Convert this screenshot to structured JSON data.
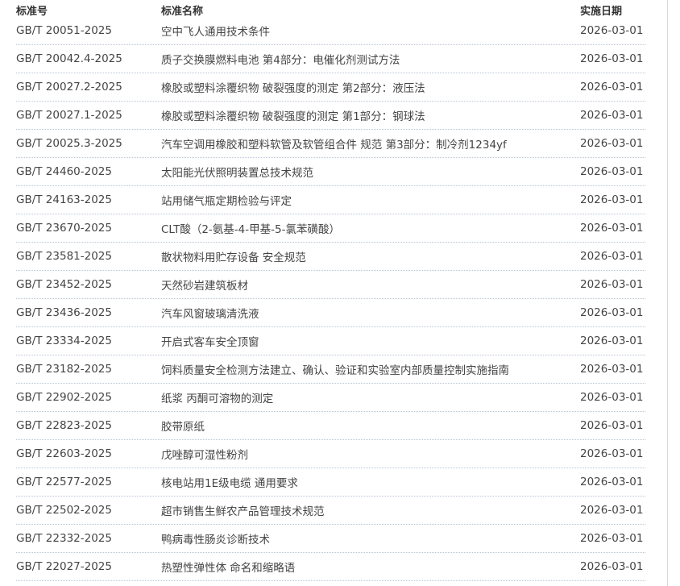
{
  "table": {
    "headers": {
      "code": "标准号",
      "name": "标准名称",
      "date": "实施日期"
    },
    "rows": [
      {
        "code": "GB/T 20051-2025",
        "name": "空中飞人通用技术条件",
        "date": "2026-03-01"
      },
      {
        "code": "GB/T 20042.4-2025",
        "name": "质子交换膜燃料电池 第4部分：电催化剂测试方法",
        "date": "2026-03-01"
      },
      {
        "code": "GB/T 20027.2-2025",
        "name": "橡胶或塑料涂覆织物 破裂强度的测定 第2部分：液压法",
        "date": "2026-03-01"
      },
      {
        "code": "GB/T 20027.1-2025",
        "name": "橡胶或塑料涂覆织物 破裂强度的测定 第1部分：钢球法",
        "date": "2026-03-01"
      },
      {
        "code": "GB/T 20025.3-2025",
        "name": "汽车空调用橡胶和塑料软管及软管组合件 规范 第3部分：制冷剂1234yf",
        "date": "2026-03-01"
      },
      {
        "code": "GB/T 24460-2025",
        "name": "太阳能光伏照明装置总技术规范",
        "date": "2026-03-01"
      },
      {
        "code": "GB/T 24163-2025",
        "name": "站用储气瓶定期检验与评定",
        "date": "2026-03-01"
      },
      {
        "code": "GB/T 23670-2025",
        "name": "CLT酸（2-氨基-4-甲基-5-氯苯磺酸）",
        "date": "2026-03-01"
      },
      {
        "code": "GB/T 23581-2025",
        "name": "散状物料用贮存设备 安全规范",
        "date": "2026-03-01"
      },
      {
        "code": "GB/T 23452-2025",
        "name": "天然砂岩建筑板材",
        "date": "2026-03-01"
      },
      {
        "code": "GB/T 23436-2025",
        "name": "汽车风窗玻璃清洗液",
        "date": "2026-03-01"
      },
      {
        "code": "GB/T 23334-2025",
        "name": "开启式客车安全顶窗",
        "date": "2026-03-01"
      },
      {
        "code": "GB/T 23182-2025",
        "name": "饲料质量安全检测方法建立、确认、验证和实验室内部质量控制实施指南",
        "date": "2026-03-01"
      },
      {
        "code": "GB/T 22902-2025",
        "name": "纸浆 丙酮可溶物的测定",
        "date": "2026-03-01"
      },
      {
        "code": "GB/T 22823-2025",
        "name": "胶带原纸",
        "date": "2026-03-01"
      },
      {
        "code": "GB/T 22603-2025",
        "name": "戊唑醇可湿性粉剂",
        "date": "2026-03-01"
      },
      {
        "code": "GB/T 22577-2025",
        "name": "核电站用1E级电缆 通用要求",
        "date": "2026-03-01"
      },
      {
        "code": "GB/T 22502-2025",
        "name": "超市销售生鲜农产品管理技术规范",
        "date": "2026-03-01"
      },
      {
        "code": "GB/T 22332-2025",
        "name": "鸭病毒性肠炎诊断技术",
        "date": "2026-03-01"
      },
      {
        "code": "GB/T 22027-2025",
        "name": "热塑性弹性体 命名和缩略语",
        "date": "2026-03-01"
      }
    ]
  }
}
